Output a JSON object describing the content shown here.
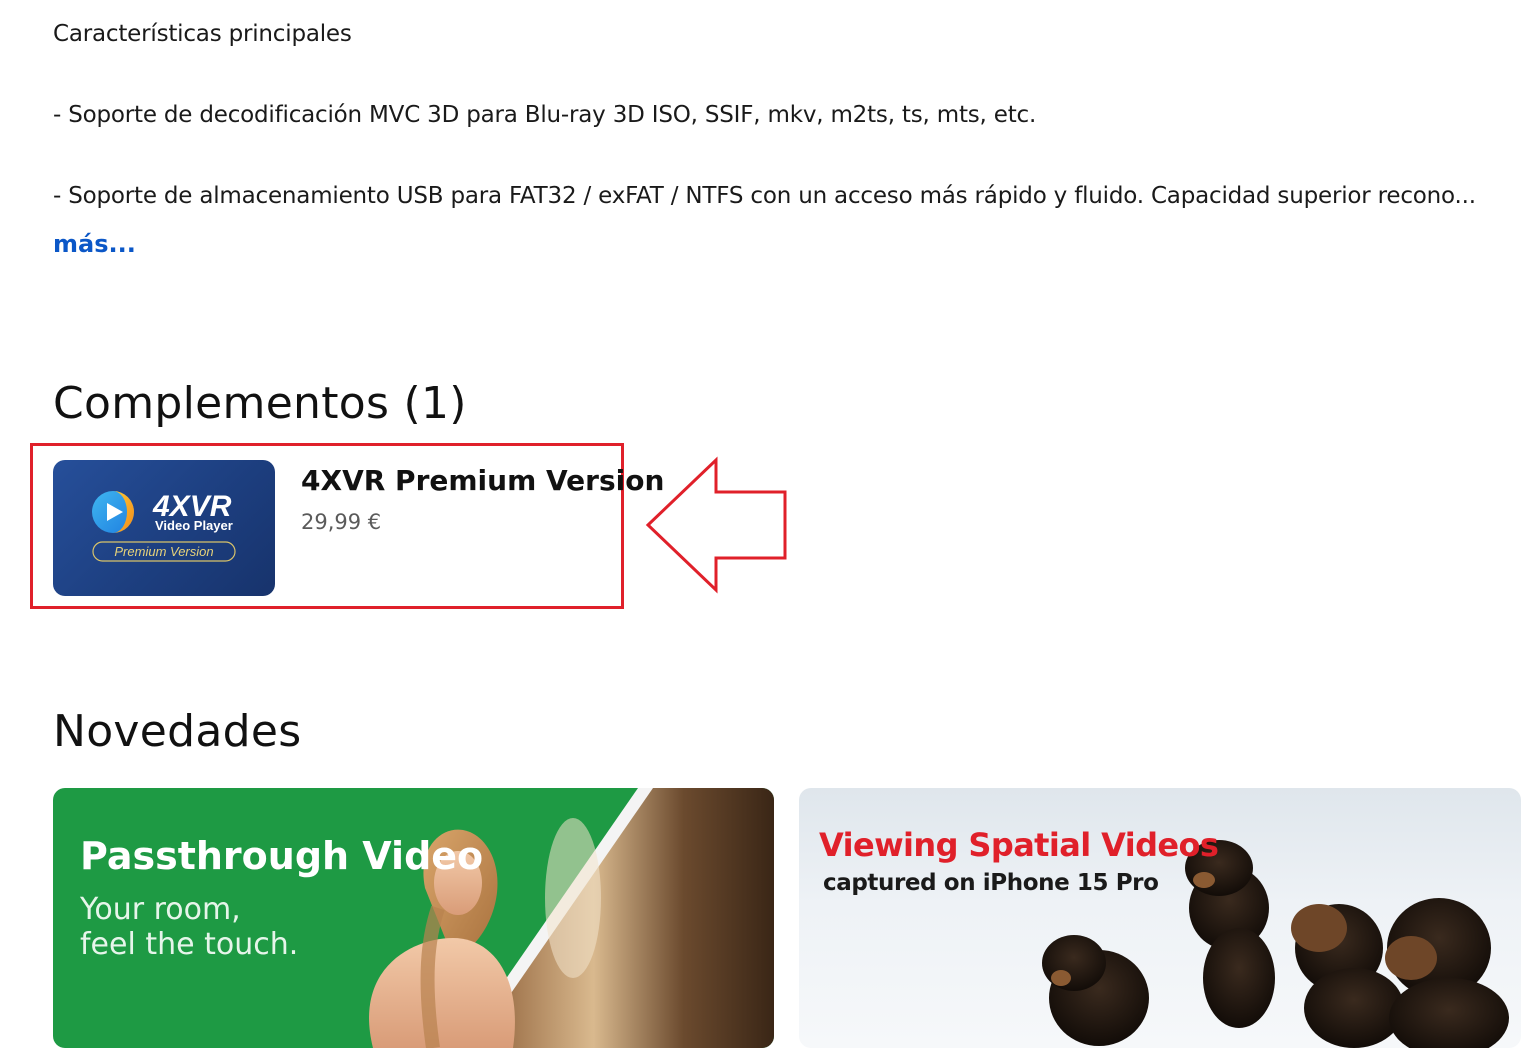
{
  "description": {
    "heading": "Características principales",
    "bullets": [
      "- Soporte de decodificación MVC 3D para Blu-ray 3D ISO, SSIF, mkv, m2ts, ts, mts, etc.",
      "- Soporte de almacenamiento USB para FAT32 / exFAT / NTFS con un acceso más rápido y fluido. Capacidad superior recono..."
    ],
    "more_link": "más..."
  },
  "addons": {
    "title": "Complementos (1)",
    "items": [
      {
        "name": "4XVR Premium Version",
        "price": "29,99 €",
        "thumb": {
          "brand": "4XVR",
          "subtitle": "Video Player",
          "badge": "Premium Version",
          "bg_color": "#1f4488"
        }
      }
    ],
    "highlight_color": "#e0202a"
  },
  "news": {
    "title": "Novedades",
    "cards": [
      {
        "title": "Passthrough Video",
        "subtitle_lines": [
          "Your room,",
          "feel the touch."
        ],
        "bg_color": "#1e9a44"
      },
      {
        "title": "Viewing Spatial Videos",
        "subtitle": "captured on iPhone 15 Pro",
        "title_color": "#e0202a"
      }
    ]
  },
  "colors": {
    "link": "#0b57c7",
    "annotation_red": "#e0202a"
  }
}
